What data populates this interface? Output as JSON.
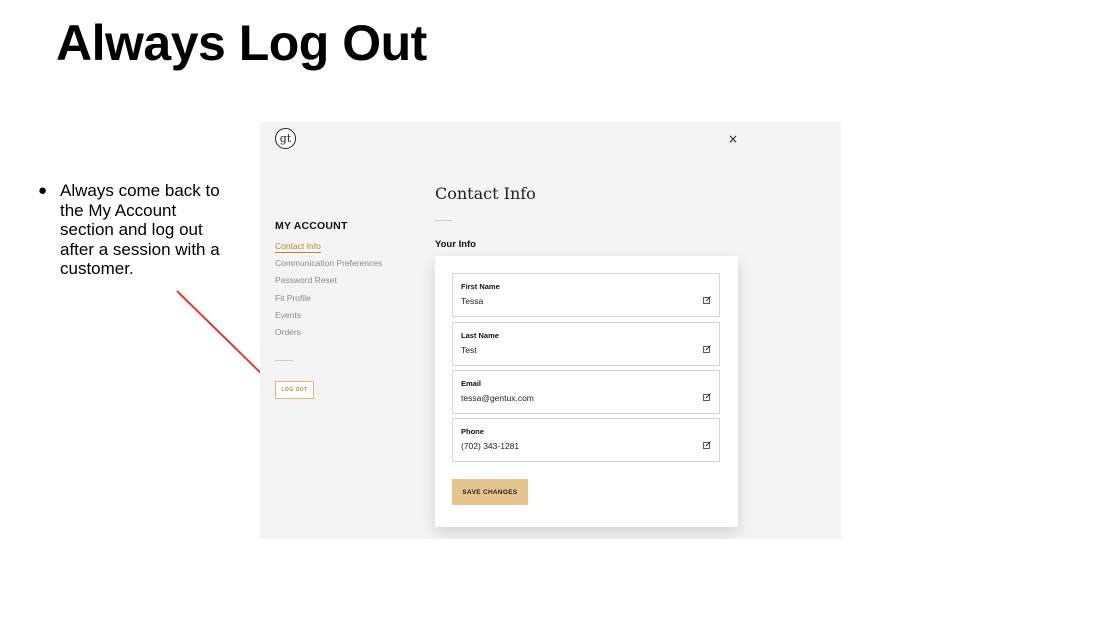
{
  "slide": {
    "title": "Always Log Out",
    "bullet_symbol": "●",
    "bullet_text": "Always come back to the My Account section and log out after a session with a customer.",
    "arrow_color": "#e53b2c"
  },
  "app": {
    "logo_text": "gt",
    "close_symbol": "×",
    "sidebar": {
      "heading": "MY ACCOUNT",
      "items": [
        {
          "label": "Contact Info",
          "active": true
        },
        {
          "label": "Communication Preferences"
        },
        {
          "label": "Password Reset"
        },
        {
          "label": "Fit Profile"
        },
        {
          "label": "Events"
        },
        {
          "label": "Orders"
        }
      ],
      "logout_label": "LOG OUT"
    },
    "main": {
      "title": "Contact Info",
      "section_label": "Your Info",
      "fields": [
        {
          "label": "First Name",
          "value": "Tessa"
        },
        {
          "label": "Last Name",
          "value": "Test"
        },
        {
          "label": "Email",
          "value": "tessa@gentux.com"
        },
        {
          "label": "Phone",
          "value": "(702) 343-1281"
        }
      ],
      "save_label": "SAVE CHANGES"
    },
    "colors": {
      "accent": "#b8862f",
      "button_bg": "#e5c48e",
      "panel_bg": "#f4f4f4"
    }
  }
}
